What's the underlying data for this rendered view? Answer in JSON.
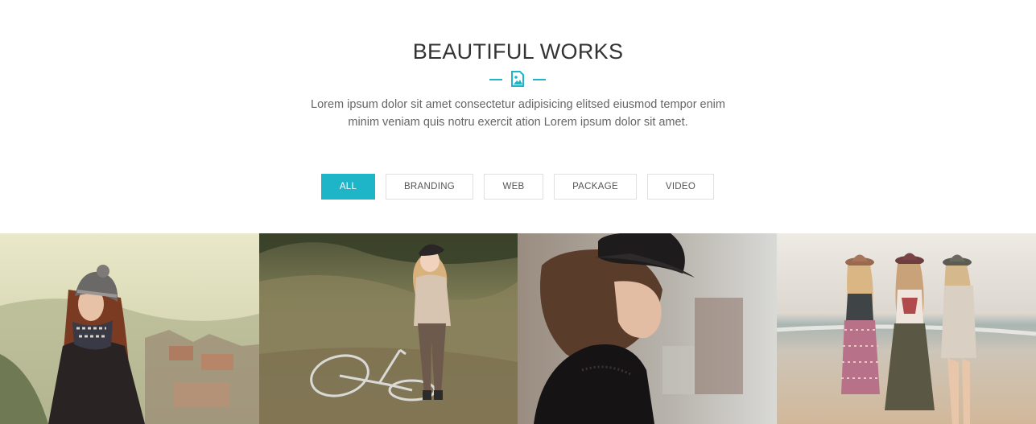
{
  "section": {
    "title": "BEAUTIFUL WORKS",
    "description_line1": "Lorem ipsum dolor sit amet consectetur adipisicing elitsed eiusmod tempor enim",
    "description_line2": "minim veniam quis notru exercit ation Lorem ipsum dolor sit amet.",
    "divider_icon": "image-icon"
  },
  "filters": [
    {
      "label": "ALL",
      "active": true
    },
    {
      "label": "BRANDING",
      "active": false
    },
    {
      "label": "WEB",
      "active": false
    },
    {
      "label": "PACKAGE",
      "active": false
    },
    {
      "label": "VIDEO",
      "active": false
    }
  ],
  "gallery": {
    "items": [
      {
        "name": "portfolio-photo-girl-knit-hat"
      },
      {
        "name": "portfolio-photo-girl-bicycle-field"
      },
      {
        "name": "portfolio-photo-girl-black-hat"
      },
      {
        "name": "portfolio-photo-three-girls-beach"
      }
    ]
  },
  "colors": {
    "accent": "#1fb5c8",
    "title": "#333333",
    "text": "#666666",
    "border": "#e0e0e0"
  }
}
